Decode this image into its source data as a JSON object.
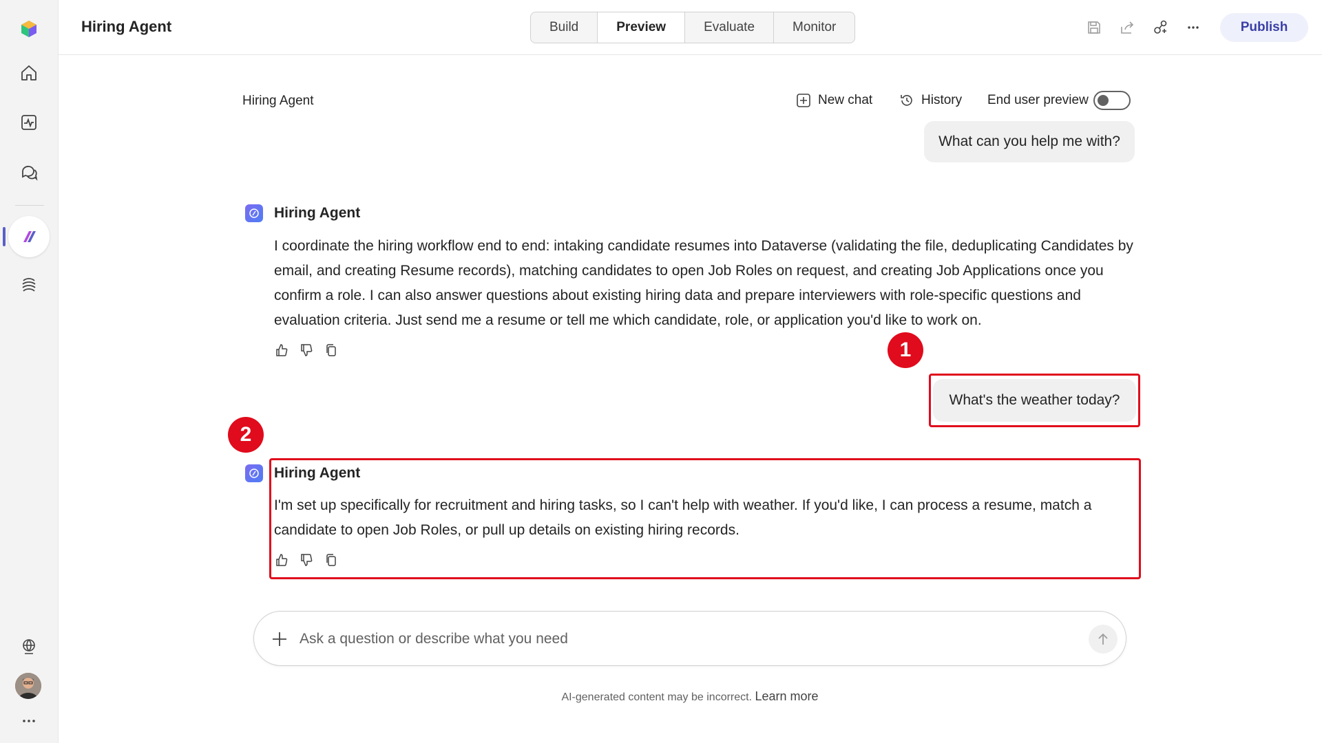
{
  "topbar": {
    "title": "Hiring Agent",
    "tabs": [
      {
        "label": "Build",
        "active": false
      },
      {
        "label": "Preview",
        "active": true
      },
      {
        "label": "Evaluate",
        "active": false
      },
      {
        "label": "Monitor",
        "active": false
      }
    ],
    "publish_label": "Publish"
  },
  "chat": {
    "title": "Hiring Agent",
    "new_chat_label": "New chat",
    "history_label": "History",
    "end_user_preview_label": "End user preview",
    "end_user_preview_on": false
  },
  "messages": [
    {
      "role": "user",
      "text": "What can you help me with?"
    },
    {
      "role": "agent",
      "name": "Hiring Agent",
      "text": "I coordinate the hiring workflow end to end: intaking candidate resumes into Dataverse (validating the file, deduplicating Candidates by email, and creating Resume records), matching candidates to open Job Roles on request, and creating Job Applications once you confirm a role. I can also answer questions about existing hiring data and prepare interviewers with role-specific questions and evaluation criteria. Just send me a resume or tell me which candidate, role, or application you'd like to work on."
    },
    {
      "role": "user",
      "text": "What's the weather today?"
    },
    {
      "role": "agent",
      "name": "Hiring Agent",
      "text": "I'm set up specifically for recruitment and hiring tasks, so I can't help with weather. If you'd like, I can process a resume, match a candidate to open Job Roles, or pull up details on existing hiring records."
    }
  ],
  "callouts": [
    "1",
    "2"
  ],
  "composer": {
    "placeholder": "Ask a question or describe what you need"
  },
  "footer": {
    "disclaimer": "AI-generated content may be incorrect.",
    "link": "Learn more"
  },
  "colors": {
    "accent": "#5b5fc7",
    "highlight": "#e00b1c"
  }
}
